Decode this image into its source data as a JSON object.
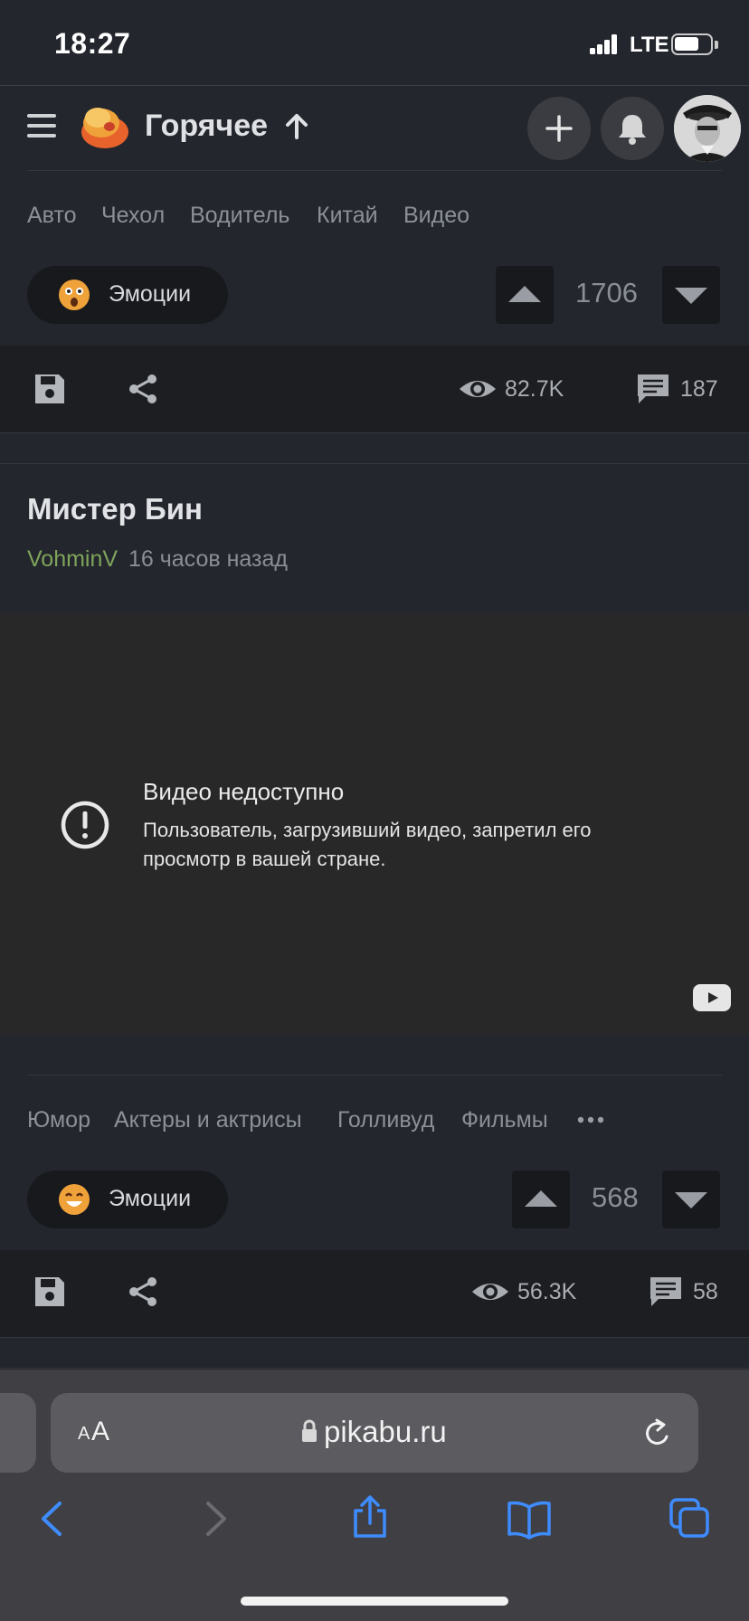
{
  "status_bar": {
    "time": "18:27",
    "network": "LTE"
  },
  "header": {
    "title": "Горячее"
  },
  "post1": {
    "tags": [
      "Авто",
      "Чехол",
      "Водитель",
      "Китай",
      "Видео"
    ],
    "emotion_label": "Эмоции",
    "rating": "1706",
    "views": "82.7K",
    "comments": "187"
  },
  "post2": {
    "title": "Мистер Бин",
    "author": "VohminV",
    "time": "16 часов назад",
    "video": {
      "title": "Видео недоступно",
      "message": "Пользователь, загрузивший видео, запретил его просмотр в вашей стране."
    },
    "tags": [
      "Юмор",
      "Актеры и актрисы",
      "Голливуд",
      "Фильмы"
    ],
    "emotion_label": "Эмоции",
    "rating": "568",
    "views": "56.3K",
    "comments": "58"
  },
  "browser": {
    "aa_small": "A",
    "aa_big": "A",
    "url": "pikabu.ru"
  },
  "colors": {
    "background": "#23262d",
    "action_bar": "#1c1e22",
    "author": "#7fa45a",
    "safari_accent": "#3f8cff"
  }
}
